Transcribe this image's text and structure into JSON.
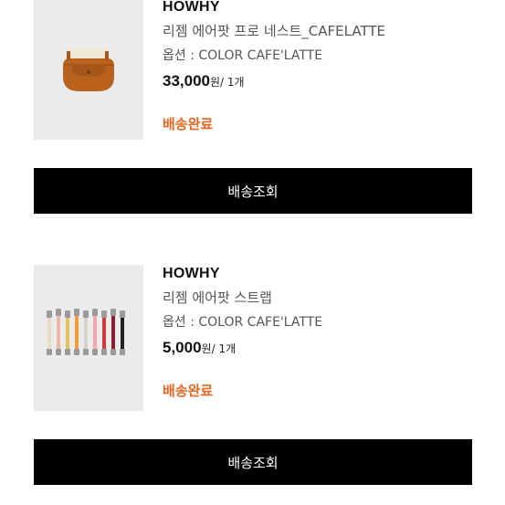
{
  "orders": [
    {
      "brand": "HOWHY",
      "product_name": "리젬 에어팟 프로 네스트_CAFELATTE",
      "option": "옵션 : COLOR CAFE'LATTE",
      "price": "33,000",
      "price_unit": "원/ 1개",
      "status": "배송완료",
      "track_label": "배송조회",
      "thumbnail_icon": "airpods-case-image"
    },
    {
      "brand": "HOWHY",
      "product_name": "리젬 에어팟 스트랩",
      "option": "옵션 : COLOR CAFE'LATTE",
      "price": "5,000",
      "price_unit": "원/ 1개",
      "status": "배송완료",
      "track_label": "배송조회",
      "thumbnail_icon": "strap-set-image"
    }
  ],
  "colors": {
    "status": "#e8661f",
    "button_bg": "#000000",
    "thumb_bg": "#ebebeb"
  }
}
